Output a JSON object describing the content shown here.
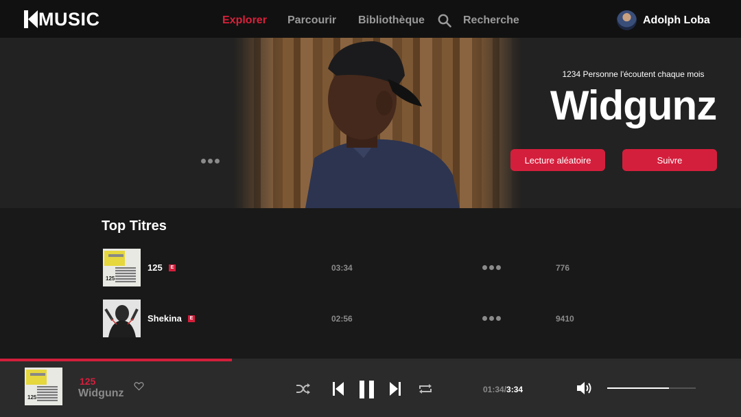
{
  "app": {
    "logo_text": "MUSIC"
  },
  "nav": {
    "explorer": "Explorer",
    "parcourir": "Parcourir",
    "bibliotheque": "Bibliothèque",
    "recherche": "Recherche"
  },
  "user": {
    "name": "Adolph Loba"
  },
  "hero": {
    "listeners": "1234 Personne l'écoutent chaque mois",
    "artist": "Widgunz",
    "shuffle_label": "Lecture aléatoire",
    "follow_label": "Suivre"
  },
  "top_titres": {
    "title": "Top Titres",
    "tracks": [
      {
        "title": "125",
        "explicit": "E",
        "duration": "03:34",
        "plays": "776"
      },
      {
        "title": "Shekina",
        "explicit": "E",
        "duration": "02:56",
        "plays": "9410"
      }
    ]
  },
  "player": {
    "title": "125",
    "artist": "Widgunz",
    "elapsed": "01:34",
    "separator": "/",
    "total": "3:34",
    "progress_fraction": 0.313,
    "volume_fraction": 0.7
  },
  "colors": {
    "accent": "#d41f3c",
    "header_bg": "#111111",
    "player_bg": "#2b2b2b"
  },
  "icons": [
    "search-icon",
    "more-icon",
    "heart-icon",
    "shuffle-icon",
    "previous-icon",
    "pause-icon",
    "next-icon",
    "repeat-icon",
    "volume-icon"
  ]
}
